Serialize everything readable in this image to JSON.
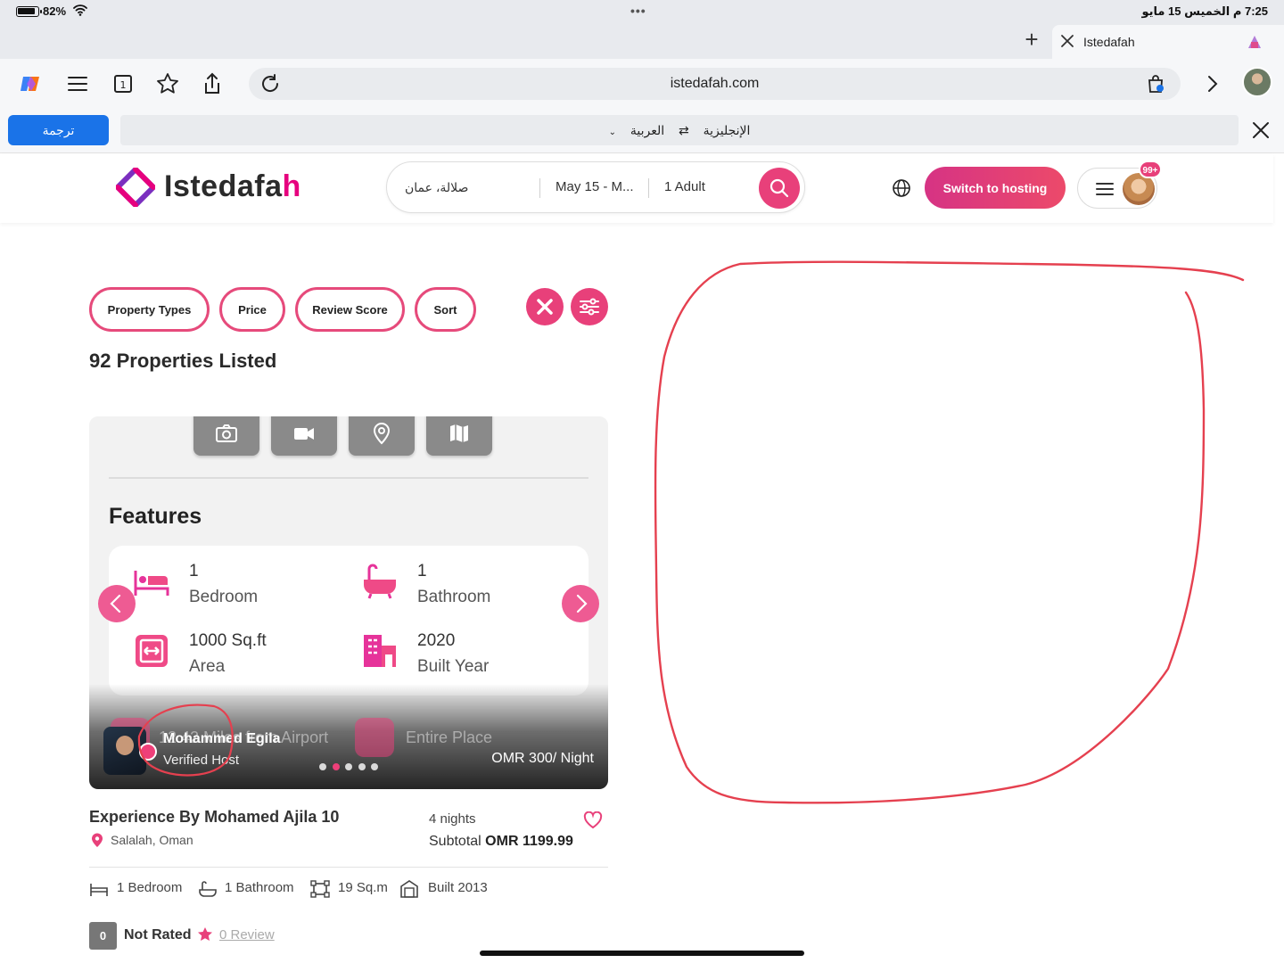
{
  "status_bar": {
    "battery": "82%",
    "clock": "7:25 م  الخميس 15 مايو"
  },
  "browser": {
    "tab_title": "Istedafah",
    "url": "istedafah.com",
    "translate": {
      "button_label": "ترجمة",
      "source_lang": "الإنجليزية",
      "target_lang": "العربية"
    }
  },
  "header": {
    "logo_main": "Istedafa",
    "logo_accent": "h",
    "search": {
      "where": "صلالة، عمان",
      "dates": "May 15 - M...",
      "guests": "1 Adult"
    },
    "hosting_label": "Switch to hosting",
    "notification_badge": "99+"
  },
  "filters": {
    "property_types": "Property Types",
    "price": "Price",
    "review_score": "Review Score",
    "sort": "Sort"
  },
  "results": {
    "title": "92 Properties Listed"
  },
  "card": {
    "features_title": "Features",
    "features": [
      {
        "value": "1",
        "label": "Bedroom"
      },
      {
        "value": "1",
        "label": "Bathroom"
      },
      {
        "value": "1000 Sq.ft",
        "label": "Area"
      },
      {
        "value": "2020",
        "label": "Built Year"
      }
    ],
    "ghost_distance": "12.42 Miles from Airport",
    "ghost_place": "Entire Place",
    "host_name": "Mohammed Egila",
    "host_status": "Verified Host",
    "price_per_night": "OMR 300/ Night",
    "slide_count": 5,
    "active_slide": 2,
    "title": "Experience By Mohamed Ajila 10",
    "location": "Salalah, Oman",
    "nights": "4 nights",
    "subtotal_label": "Subtotal",
    "subtotal_value": "OMR 1199.99",
    "specs": {
      "bedroom": "1 Bedroom",
      "bathroom": "1 Bathroom",
      "area": "19 Sq.m",
      "built": "Built 2013"
    },
    "rating": {
      "score": "0",
      "label": "Not Rated",
      "reviews": "0 Review"
    }
  },
  "colors": {
    "brand_pink": "#e8407a",
    "annotation_red": "#e5404f",
    "translate_blue": "#1a73e8"
  }
}
